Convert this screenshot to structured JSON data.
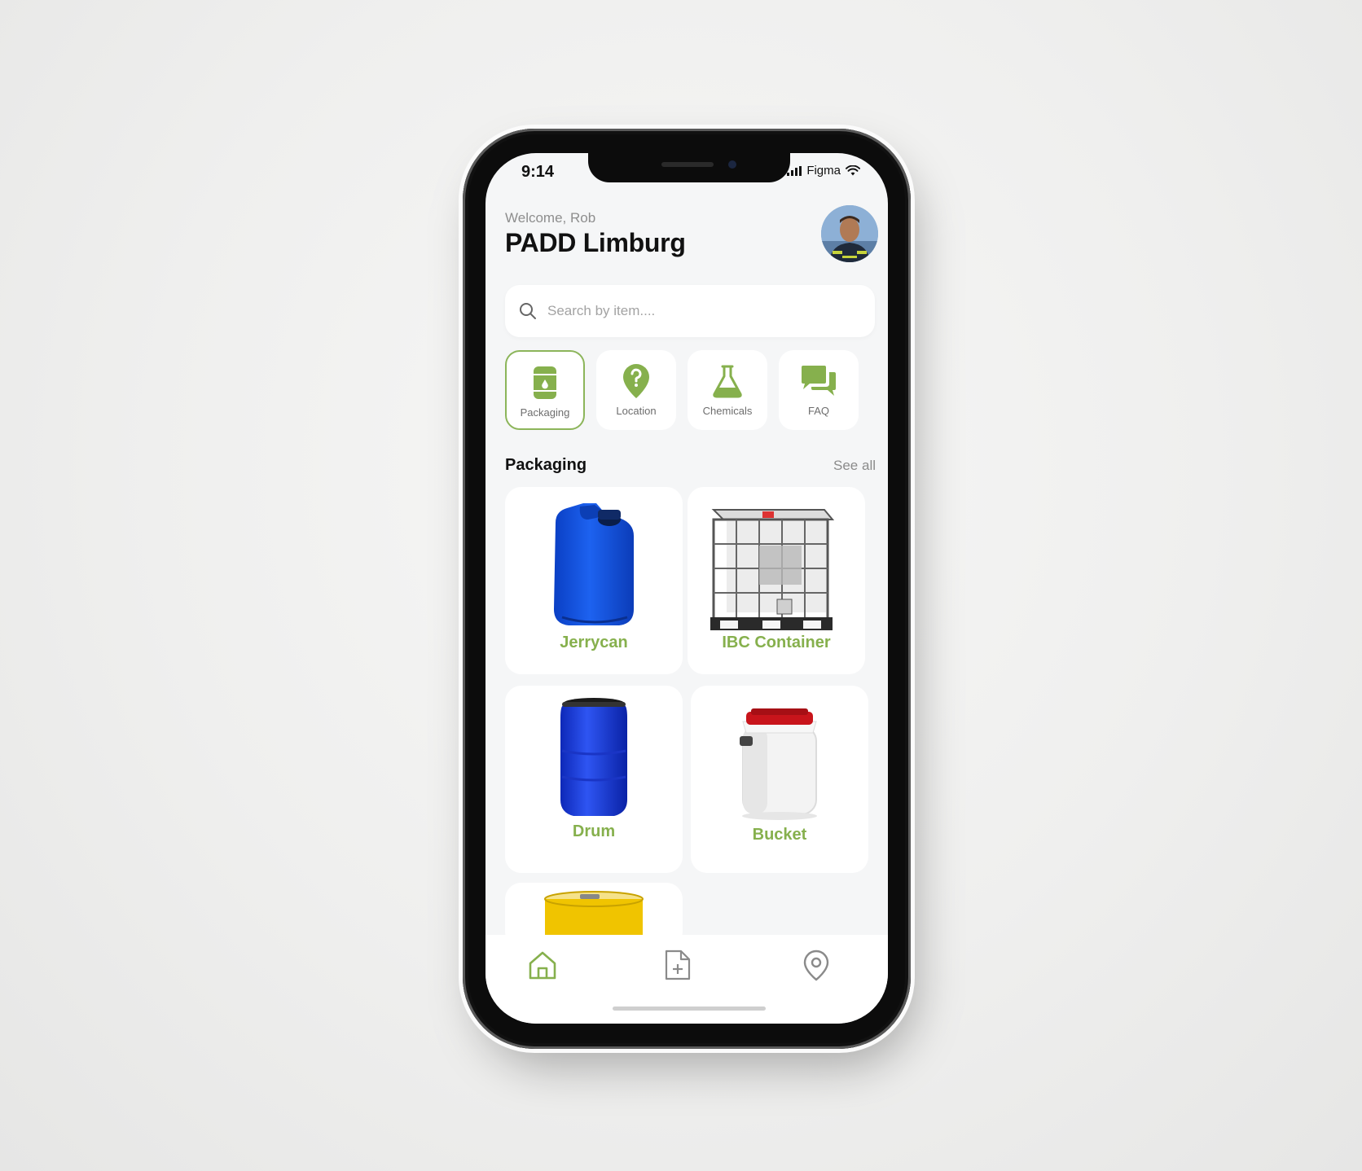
{
  "status_bar": {
    "time": "9:14",
    "carrier": "Figma"
  },
  "header": {
    "welcome": "Welcome, Rob",
    "title": "PADD Limburg"
  },
  "search": {
    "placeholder": "Search by item...."
  },
  "categories": [
    {
      "label": "Packaging",
      "icon": "barrel-icon",
      "active": true
    },
    {
      "label": "Location",
      "icon": "location-question-icon",
      "active": false
    },
    {
      "label": "Chemicals",
      "icon": "flask-icon",
      "active": false
    },
    {
      "label": "FAQ",
      "icon": "chat-bubbles-icon",
      "active": false
    }
  ],
  "section": {
    "title": "Packaging",
    "see_all": "See all"
  },
  "products": [
    {
      "name": "Jerrycan",
      "color": "#1552d8"
    },
    {
      "name": "IBC Container",
      "color": "#e9e9e9"
    },
    {
      "name": "Drum",
      "color": "#1d3ee0"
    },
    {
      "name": "Bucket",
      "color": "#f4f4f4"
    },
    {
      "name": "",
      "color": "#f0c400"
    }
  ],
  "tabbar": [
    {
      "icon": "home-icon",
      "active": true
    },
    {
      "icon": "add-document-icon",
      "active": false
    },
    {
      "icon": "map-pin-icon",
      "active": false
    }
  ],
  "colors": {
    "accent": "#86b04d",
    "background": "#f5f6f7"
  }
}
